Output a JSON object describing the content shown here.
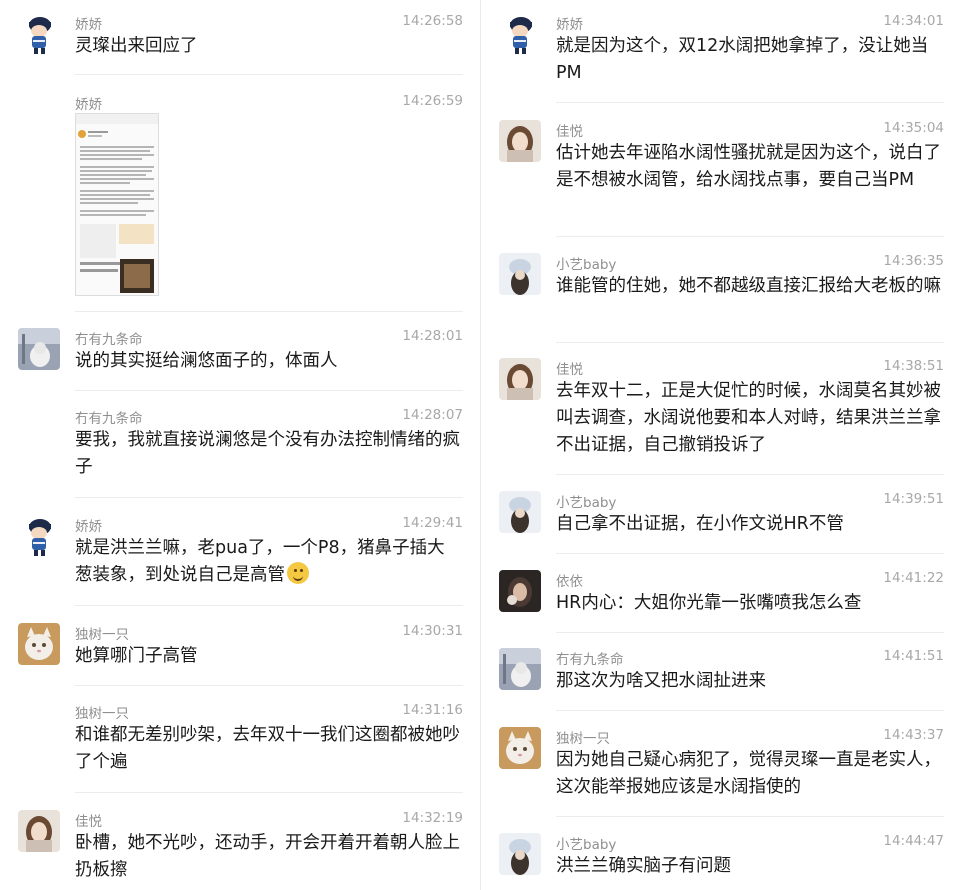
{
  "colors": {
    "name": "#8f8f8f",
    "time": "#a8a8a8",
    "text": "#1a1a1a",
    "divider": "#ececec"
  },
  "left_messages": [
    {
      "sender": "娇娇",
      "time": "14:26:58",
      "text": "灵璨出来回应了",
      "avatar": "cartoon-boy"
    },
    {
      "sender": "娇娇",
      "time": "14:26:59",
      "text": "",
      "attachment": "screenshot-image",
      "avatar": "none"
    },
    {
      "sender": "冇有九条命",
      "time": "14:28:01",
      "text": "说的其实挺给澜悠面子的，体面人",
      "avatar": "snow-cat"
    },
    {
      "sender": "冇有九条命",
      "time": "14:28:07",
      "text": "要我，我就直接说澜悠是个没有办法控制情绪的疯子",
      "avatar": "none"
    },
    {
      "sender": "娇娇",
      "time": "14:29:41",
      "text": "就是洪兰兰嘛，老pua了，一个P8，猪鼻子插大葱装象，到处说自己是高管",
      "emoji": "smirk-emoji",
      "avatar": "cartoon-boy"
    },
    {
      "sender": "独树一只",
      "time": "14:30:31",
      "text": "她算哪门子高管",
      "avatar": "white-cat"
    },
    {
      "sender": "独树一只",
      "time": "14:31:16",
      "text": "和谁都无差别吵架，去年双十一我们这圈都被她吵了个遍",
      "avatar": "none"
    },
    {
      "sender": "佳悦",
      "time": "14:32:19",
      "text": "卧槽，她不光吵，还动手，开会开着开着朝人脸上扔板擦",
      "avatar": "girl-photo"
    }
  ],
  "right_messages": [
    {
      "sender": "娇娇",
      "time": "14:34:01",
      "text": "就是因为这个，双12水阔把她拿掉了，没让她当PM",
      "avatar": "cartoon-boy"
    },
    {
      "sender": "佳悦",
      "time": "14:35:04",
      "text": "估计她去年诬陷水阔性骚扰就是因为这个，说白了是不想被水阔管，给水阔找点事，要自己当PM",
      "avatar": "girl-photo"
    },
    {
      "sender": "小艺baby",
      "time": "14:36:35",
      "text": "谁能管的住她，她不都越级直接汇报给大老板的嘛",
      "avatar": "hat-girl"
    },
    {
      "sender": "佳悦",
      "time": "14:38:51",
      "text": "去年双十二，正是大促忙的时候，水阔莫名其妙被叫去调查，水阔说他要和本人对峙，结果洪兰兰拿不出证据，自己撤销投诉了",
      "avatar": "girl-photo"
    },
    {
      "sender": "小艺baby",
      "time": "14:39:51",
      "text": "自己拿不出证据，在小作文说HR不管",
      "avatar": "hat-girl"
    },
    {
      "sender": "依依",
      "time": "14:41:22",
      "text": "HR内心：大姐你光靠一张嘴喷我怎么查",
      "avatar": "dark-girl"
    },
    {
      "sender": "冇有九条命",
      "time": "14:41:51",
      "text": "那这次为啥又把水阔扯进来",
      "avatar": "snow-cat"
    },
    {
      "sender": "独树一只",
      "time": "14:43:37",
      "text": "因为她自己疑心病犯了，觉得灵璨一直是老实人，这次能举报她应该是水阔指使的",
      "avatar": "white-cat"
    },
    {
      "sender": "小艺baby",
      "time": "14:44:47",
      "text": "洪兰兰确实脑子有问题",
      "avatar": "hat-girl"
    }
  ]
}
